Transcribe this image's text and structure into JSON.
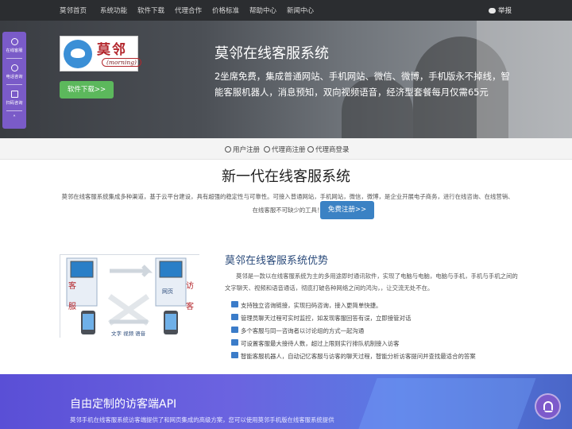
{
  "nav": {
    "items": [
      "莫邻首页",
      "系统功能",
      "软件下载",
      "代理合作",
      "价格标准",
      "帮助中心",
      "新闻中心"
    ],
    "report": "举报"
  },
  "hero": {
    "logo_cn": "莫邻",
    "logo_en": "(morning)",
    "download": "软件下载>>",
    "title": "莫邻在线客服系统",
    "desc": "2坐席免费，集成普通网站、手机网站、微信、微博，手机版永不掉线，智能客服机器人，消息预知，双向视频语音，经济型套餐每月仅需65元"
  },
  "float_side": {
    "items": [
      "在线客服",
      "电话咨询",
      "扫码咨询"
    ],
    "up": "˄"
  },
  "regbar": {
    "links": [
      "用户注册",
      "代理商注册",
      "代理商登录"
    ]
  },
  "section1": {
    "title": "新一代在线客服系统",
    "desc": "莫邻在线客服系统集成多种渠道，基于云平台建设，具有超强的稳定性与可靠性。可接入普通网站，手机网站，微信，微博，是企业开展电子商务，进行在线咨询、在线营销、在线客服不可缺少的工具！",
    "register": "免费注册>>"
  },
  "section2": {
    "diagram_labels": [
      "客",
      "服",
      "访",
      "客",
      "网页",
      "文字 视频 语音"
    ],
    "title": "莫邻在线客服系统优势",
    "desc": "莫邻是一款以在线客服系统为主的多用途即时通讯软件，实现了电脑与电脑，电脑与手机，手机与手机之间的文字聊天、视频和语音通话，彻底打破各种网络之间的鸿沟，，让交流无处不在。",
    "features": [
      "支持独立咨询链接，实现扫码咨询，接入更简单快捷。",
      "管理员聊天过程可实时监控，如发现客服回答有误，立即接管对话",
      "多个客服与同一咨询者以讨论组的方式一起沟通",
      "可设置客服最大接待人数，超过上限则实行排队机制接入访客",
      "智能客服机器人，自动记忆客服与访客的聊天过程，智能分析访客提问并查找最适合的答案"
    ]
  },
  "banner": {
    "title": "自由定制的访客端API",
    "desc": "莫邻手机在线客服系统访客端提供了和网页集成的高级方案，您可以使用莫邻手机版在线客服系统提供"
  },
  "colors": {
    "nav_bg": "#2b2d30",
    "side_purple": "#7a5bc8",
    "green_btn": "#5cb85c",
    "blue_btn": "#3b82c4",
    "banner": "#5a4fd6"
  }
}
